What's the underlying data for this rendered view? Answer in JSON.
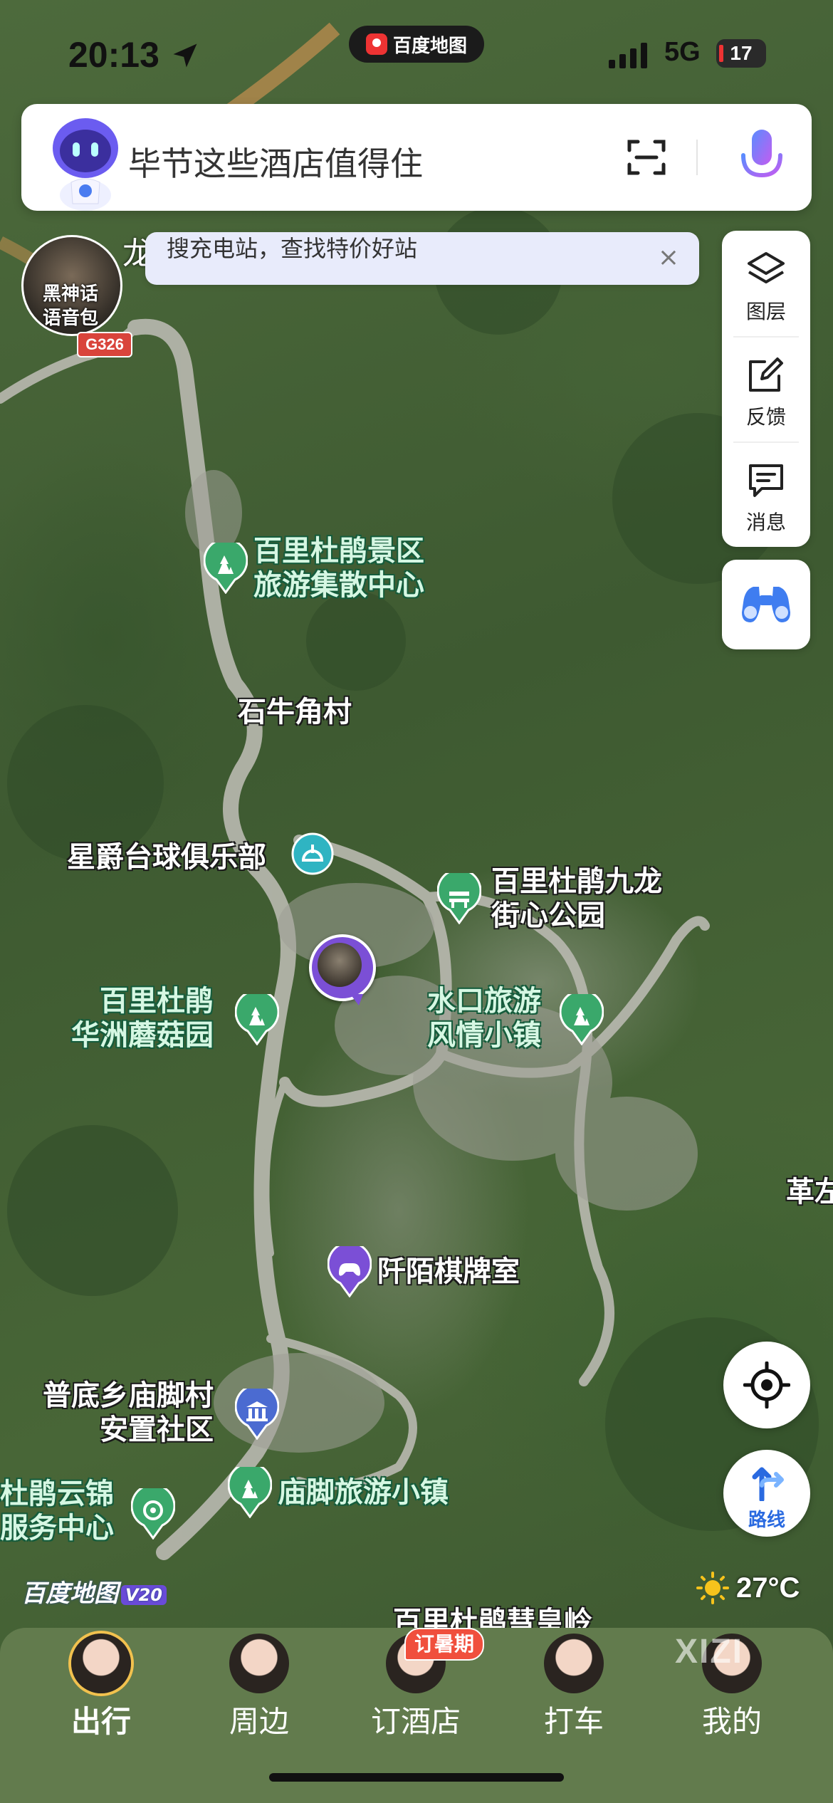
{
  "status_bar": {
    "time": "20:13",
    "app_name": "百度地图",
    "network": "5G",
    "battery": "17"
  },
  "search": {
    "placeholder": "毕节这些酒店值得住",
    "scan_icon": "scan-icon",
    "mic_icon": "mic-icon"
  },
  "voice_pack": {
    "label_line1": "黑神话",
    "label_line2": "语音包",
    "road_badge": "G326"
  },
  "tip": {
    "text": "搜充电站，查找特价好站",
    "close": "×",
    "partial_label": "龙"
  },
  "toolbar": {
    "layers_label": "图层",
    "feedback_label": "反馈",
    "messages_label": "消息"
  },
  "map": {
    "pois": [
      {
        "line1": "百里杜鹃景区",
        "line2": "旅游集散中心",
        "icon": "park-icon"
      },
      {
        "line1": "石牛角村",
        "line2": ""
      },
      {
        "line1": "星爵台球俱乐部",
        "line2": "",
        "icon": "billiards-icon"
      },
      {
        "line1": "百里杜鹃九龙",
        "line2": "街心公园",
        "icon": "park-bench-icon"
      },
      {
        "line1": "百里杜鹃",
        "line2": "华洲蘑菇园",
        "icon": "park-icon"
      },
      {
        "line1": "水口旅游",
        "line2": "风情小镇",
        "icon": "park-icon"
      },
      {
        "line1": "阡陌棋牌室",
        "line2": "",
        "icon": "game-icon"
      },
      {
        "line1": "普底乡庙脚村",
        "line2": "安置社区",
        "icon": "building-icon"
      },
      {
        "line1": "庙脚旅游小镇",
        "line2": "",
        "icon": "park-icon"
      },
      {
        "line1": "杜鹃云锦",
        "line2": "服务中心",
        "icon": "service-icon"
      },
      {
        "line1": "百里杜鹃彗皇岭",
        "line2": ""
      },
      {
        "line1": "革左",
        "line2": ""
      }
    ],
    "brand": "百度地图",
    "brand_version": "V20",
    "temperature": "27°C"
  },
  "route_button": {
    "label": "路线"
  },
  "bottom_nav": {
    "items": [
      {
        "label": "出行",
        "active": true
      },
      {
        "label": "周边",
        "active": false
      },
      {
        "label": "订酒店",
        "active": false,
        "badge": "订暑期"
      },
      {
        "label": "打车",
        "active": false
      },
      {
        "label": "我的",
        "active": false
      }
    ],
    "watermark": "XIZI"
  },
  "colors": {
    "accent_blue": "#2a6ae0",
    "poi_green": "#3aa86b",
    "poi_purple": "#7b4fd6",
    "poi_teal": "#2fb4c2",
    "badge_red": "#f04f3d"
  }
}
